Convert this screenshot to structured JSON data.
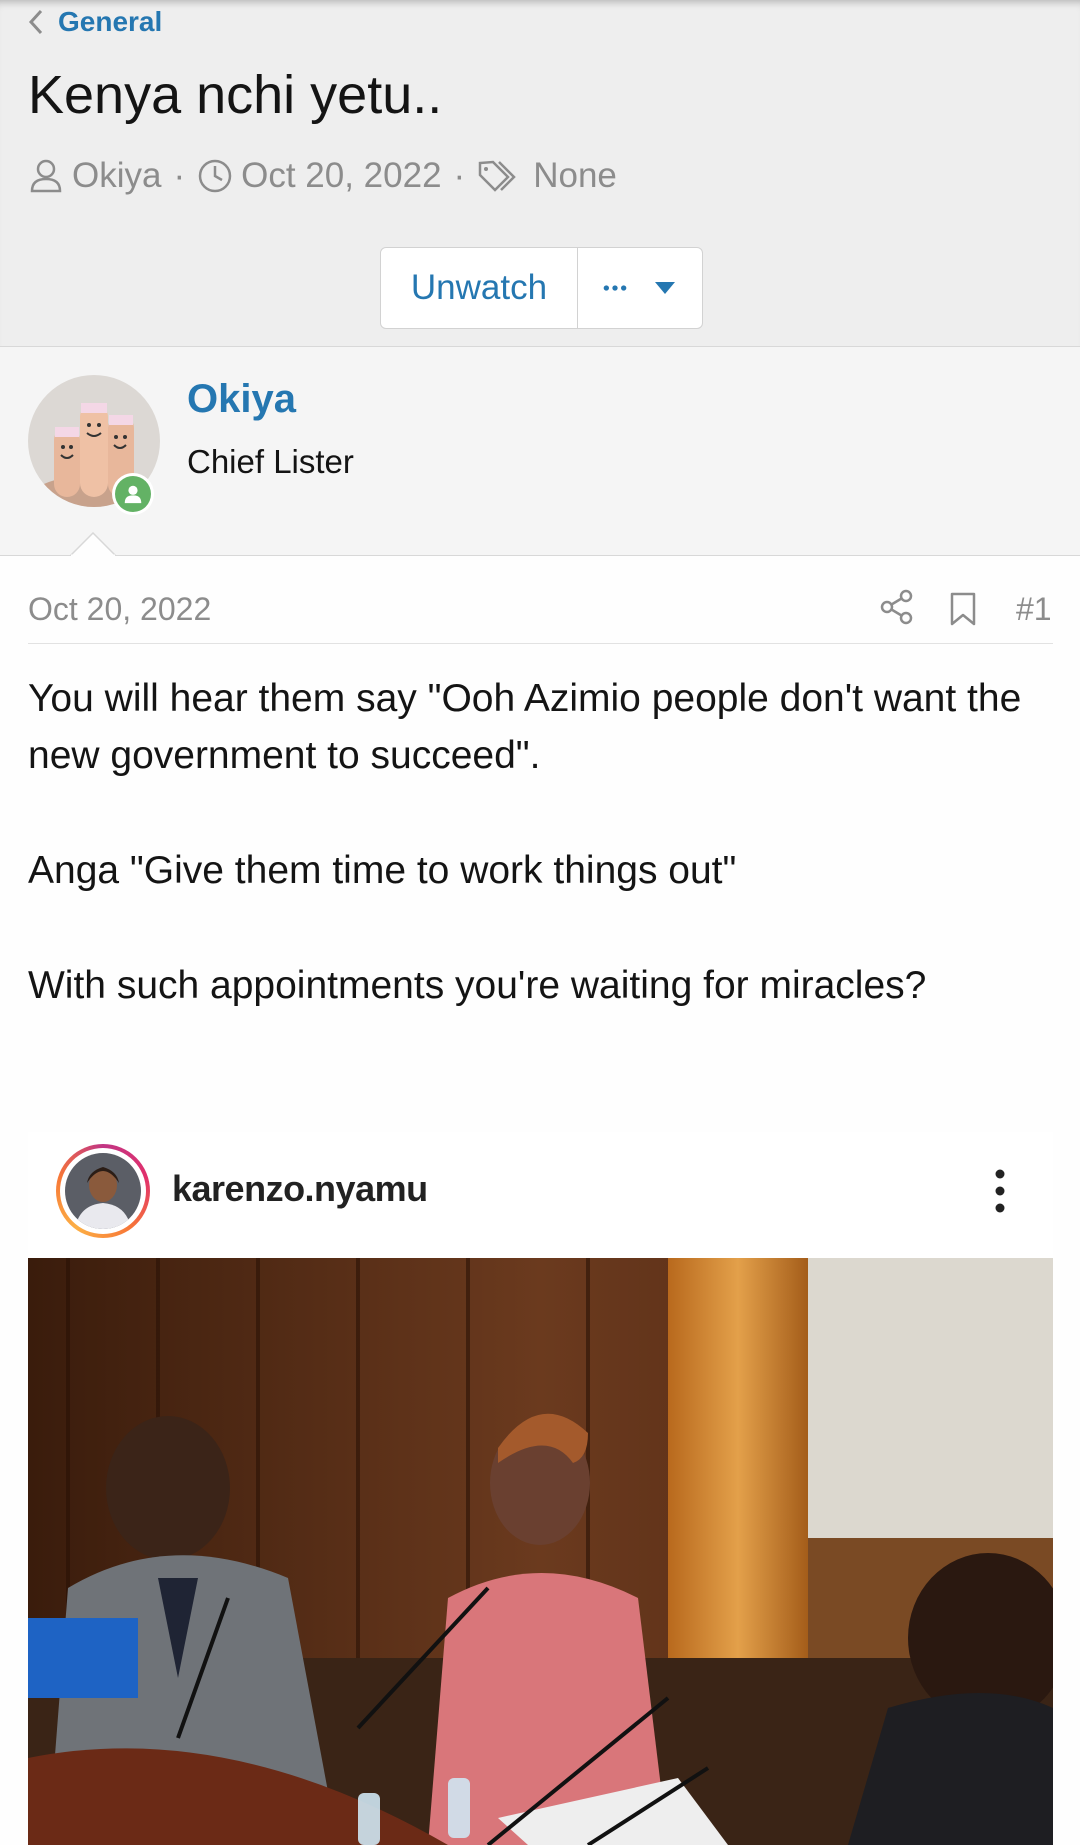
{
  "breadcrumb": {
    "label": "General"
  },
  "thread": {
    "title": "Kenya nchi yetu..",
    "author": "Okiya",
    "date": "Oct 20, 2022",
    "tags": "None",
    "separator": "·"
  },
  "actions": {
    "unwatch_label": "Unwatch"
  },
  "user": {
    "name": "Okiya",
    "title": "Chief Lister",
    "status": "online"
  },
  "post": {
    "date": "Oct 20, 2022",
    "number": "#1",
    "paragraphs": [
      "You will hear them say \"Ooh Azimio people don't want the new government to succeed\".",
      "Anga \"Give them time to work things out\"",
      "With such appointments you're waiting for miracles?"
    ]
  },
  "embed": {
    "username": "karenzo.nyamu"
  },
  "colors": {
    "link": "#2577b1",
    "muted": "#8c8c8c",
    "online": "#63b265"
  },
  "icons": [
    "chevron-left-icon",
    "user-icon",
    "clock-icon",
    "tag-icon",
    "more-dots-icon",
    "caret-down-icon",
    "share-icon",
    "bookmark-icon",
    "kebab-menu-icon"
  ]
}
